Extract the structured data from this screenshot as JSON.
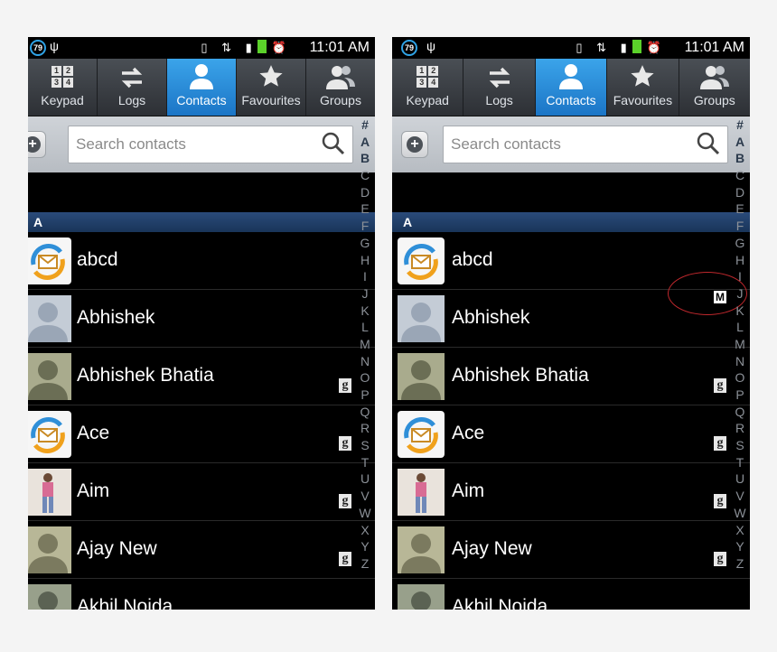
{
  "status": {
    "badge": "79",
    "time": "11:01 AM"
  },
  "tabs": [
    {
      "label": "Keypad",
      "icon": "keypad-icon"
    },
    {
      "label": "Logs",
      "icon": "logs-icon"
    },
    {
      "label": "Contacts",
      "icon": "contacts-icon",
      "active": true
    },
    {
      "label": "Favourites",
      "icon": "star-icon"
    },
    {
      "label": "Groups",
      "icon": "groups-icon"
    }
  ],
  "keypad_keys": [
    "1",
    "2",
    "3",
    "4"
  ],
  "search": {
    "placeholder": "Search contacts"
  },
  "index_letters": [
    "#",
    "A",
    "B",
    "C",
    "D",
    "E",
    "F",
    "G",
    "H",
    "I",
    "J",
    "K",
    "L",
    "M",
    "N",
    "O",
    "P",
    "Q",
    "R",
    "S",
    "T",
    "U",
    "V",
    "W",
    "X",
    "Y",
    "Z"
  ],
  "section_header": "A",
  "contacts": [
    {
      "name": "abcd",
      "avatar": "sync-avatar",
      "google": false
    },
    {
      "name": "Abhishek",
      "avatar": "default-avatar",
      "google": false
    },
    {
      "name": "Abhishek Bhatia",
      "avatar": "default-avatar",
      "google": true
    },
    {
      "name": "Ace",
      "avatar": "sync-avatar",
      "google": true
    },
    {
      "name": "Aim",
      "avatar": "photo-avatar",
      "google": true
    },
    {
      "name": "Ajay New",
      "avatar": "default-avatar",
      "google": true
    },
    {
      "name": "Akhil Noida",
      "avatar": "default-avatar",
      "google": true
    }
  ],
  "google_badge": "g",
  "scroll_indicator": "M",
  "colors": {
    "accent": "#1b75c6",
    "section": "#1f3e69",
    "highlight_circle": "#c0282d"
  }
}
